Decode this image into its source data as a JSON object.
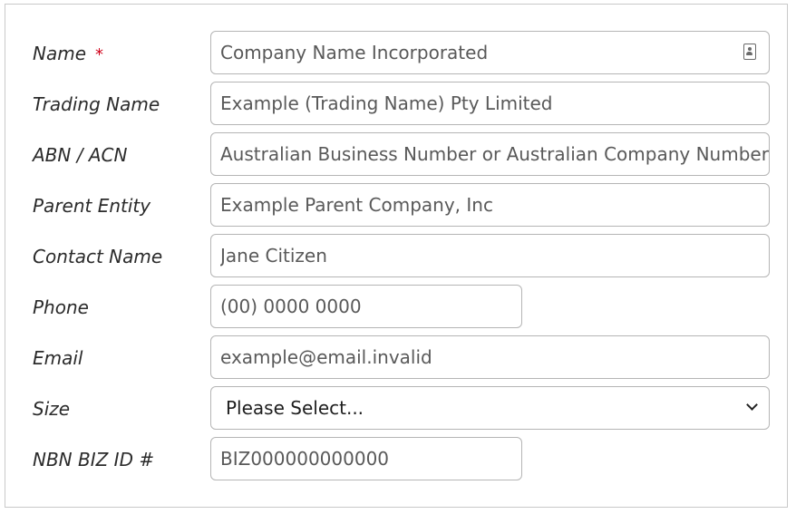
{
  "form": {
    "fields": [
      {
        "label": "Name",
        "required_mark": "*",
        "value": "Company Name Incorporated",
        "icon": "contact-card-icon"
      },
      {
        "label": "Trading Name",
        "value": "Example (Trading Name) Pty Limited"
      },
      {
        "label": "ABN / ACN",
        "value": "Australian Business Number or Australian Company Number"
      },
      {
        "label": "Parent Entity",
        "value": "Example Parent Company, Inc"
      },
      {
        "label": "Contact Name",
        "value": "Jane Citizen"
      },
      {
        "label": "Phone",
        "value": "(00) 0000 0000"
      },
      {
        "label": "Email",
        "value": "example@email.invalid"
      },
      {
        "label": "Size",
        "value": "Please Select...",
        "icon": "chevron-down-icon"
      },
      {
        "label": "NBN BIZ ID #",
        "value": "BIZ000000000000"
      }
    ]
  },
  "colors": {
    "required": "#d0021b",
    "border": "#b5b5b5",
    "label_text": "#2b2b2b",
    "placeholder_text": "#595959"
  }
}
